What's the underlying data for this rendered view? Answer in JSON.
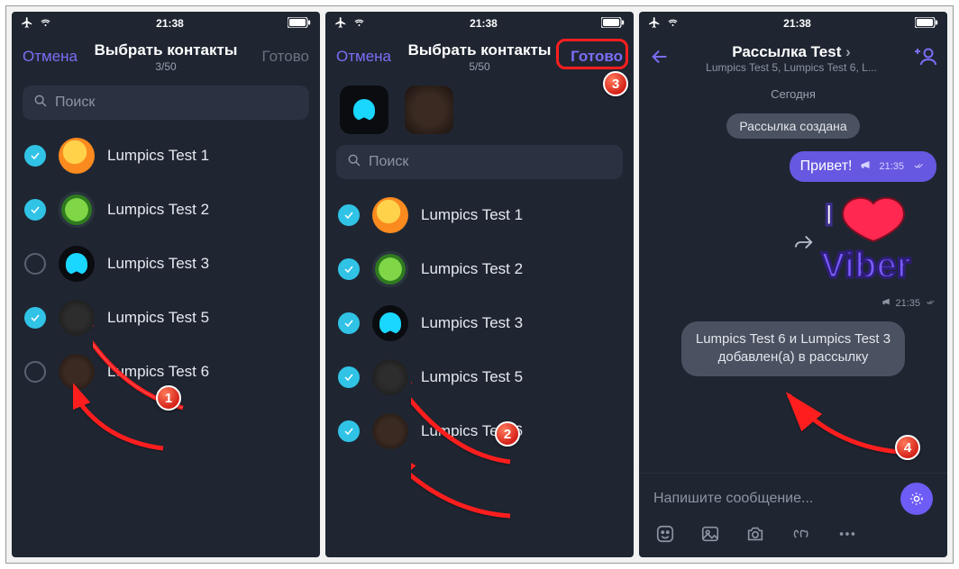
{
  "status": {
    "time": "21:38"
  },
  "screen1": {
    "cancel": "Отмена",
    "title": "Выбрать контакты",
    "counter": "3/50",
    "done": "Готово",
    "search_placeholder": "Поиск",
    "contacts": [
      {
        "name": "Lumpics Test 1",
        "checked": true,
        "avatar": "orange"
      },
      {
        "name": "Lumpics Test 2",
        "checked": true,
        "avatar": "green"
      },
      {
        "name": "Lumpics Test 3",
        "checked": false,
        "avatar": "cyan"
      },
      {
        "name": "Lumpics Test 5",
        "checked": true,
        "avatar": "blur1"
      },
      {
        "name": "Lumpics Test 6",
        "checked": false,
        "avatar": "blur2"
      }
    ]
  },
  "screen2": {
    "cancel": "Отмена",
    "title": "Выбрать контакты",
    "counter": "5/50",
    "done": "Готово",
    "search_placeholder": "Поиск",
    "contacts": [
      {
        "name": "Lumpics Test 1",
        "checked": true,
        "avatar": "orange"
      },
      {
        "name": "Lumpics Test 2",
        "checked": true,
        "avatar": "green"
      },
      {
        "name": "Lumpics Test 3",
        "checked": true,
        "avatar": "cyan"
      },
      {
        "name": "Lumpics Test 5",
        "checked": true,
        "avatar": "blur1"
      },
      {
        "name": "Lumpics Test 6",
        "checked": true,
        "avatar": "blur2"
      }
    ]
  },
  "screen3": {
    "title": "Рассылка Test",
    "subtitle": "Lumpics Test 5, Lumpics Test 6, L...",
    "day": "Сегодня",
    "created_pill": "Рассылка создана",
    "msg1_text": "Привет!",
    "msg1_time": "21:35",
    "sticker_time": "21:35",
    "sys_line1": "Lumpics Test 6 и Lumpics Test 3",
    "sys_line2": "добавлен(а) в рассылку",
    "compose_placeholder": "Напишите сообщение..."
  },
  "badges": {
    "b1": "1",
    "b2": "2",
    "b3": "3",
    "b4": "4"
  }
}
